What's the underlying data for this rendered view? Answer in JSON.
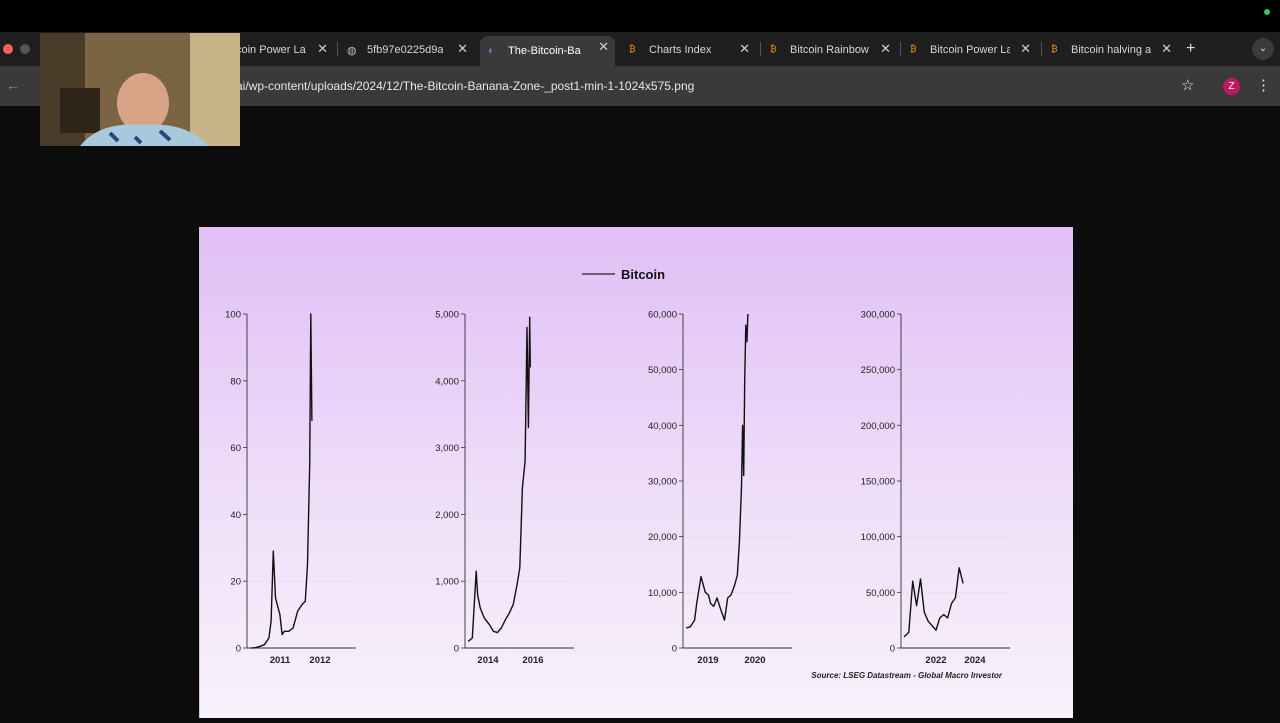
{
  "browser": {
    "tabs": [
      {
        "label": "coin Power La",
        "favicon": "bitcoin-icon"
      },
      {
        "label": "5fb97e0225d9a",
        "favicon": "globe-icon"
      },
      {
        "label": "The-Bitcoin-Ba",
        "favicon": "site-icon",
        "active": true
      },
      {
        "label": "Charts Index",
        "favicon": "bitcoin-icon"
      },
      {
        "label": "Bitcoin Rainbow",
        "favicon": "bitcoin-icon"
      },
      {
        "label": "Bitcoin Power La",
        "favicon": "bitcoin-icon"
      },
      {
        "label": "Bitcoin halving a",
        "favicon": "bitcoin-icon"
      }
    ],
    "new_tab": "+",
    "url": "ai/wp-content/uploads/2024/12/The-Bitcoin-Banana-Zone-_post1-min-1-1024x575.png",
    "profile_initial": "Z",
    "close_glyph": "✕"
  },
  "chart_data": {
    "type": "line",
    "legend": "Bitcoin",
    "source": "Source: LSEG Datastream - Global Macro Investor",
    "panels": [
      {
        "yticks": [
          "100",
          "80",
          "60",
          "40",
          "20",
          "0"
        ],
        "ymax": 100,
        "xticks": [
          "2011",
          "2012"
        ],
        "x": [
          2010.5,
          2010.7,
          2010.9,
          2011.1,
          2011.3,
          2011.4,
          2011.5,
          2011.6,
          2011.8,
          2011.9,
          2012.0,
          2012.2,
          2012.4,
          2012.6,
          2012.8,
          2012.95,
          2013.05,
          2013.15,
          2013.2,
          2013.25
        ],
        "y": [
          0,
          0.1,
          0.5,
          1,
          3,
          8,
          29,
          15,
          10,
          4,
          5,
          5,
          6,
          11,
          13,
          14,
          25,
          55,
          100,
          68
        ]
      },
      {
        "yticks": [
          "5,000",
          "4,000",
          "3,000",
          "2,000",
          "1,000",
          "0"
        ],
        "ymax": 5000,
        "xticks": [
          "2014",
          "2016"
        ],
        "x": [
          2013.3,
          2013.6,
          2013.9,
          2014.0,
          2014.2,
          2014.5,
          2014.9,
          2015.2,
          2015.5,
          2015.8,
          2016.1,
          2016.4,
          2016.7,
          2017.0,
          2017.2,
          2017.4,
          2017.6,
          2017.75,
          2017.85,
          2017.95,
          2018.0
        ],
        "y": [
          100,
          150,
          1150,
          800,
          600,
          450,
          350,
          250,
          230,
          300,
          420,
          520,
          650,
          950,
          1200,
          2400,
          2800,
          4800,
          3300,
          4950,
          4200
        ]
      },
      {
        "yticks": [
          "60,000",
          "50,000",
          "40,000",
          "30,000",
          "20,000",
          "10,000",
          "0"
        ],
        "ymax": 60000,
        "xticks": [
          "2019",
          "2020"
        ],
        "x": [
          2018.4,
          2018.6,
          2018.8,
          2018.9,
          2019.1,
          2019.3,
          2019.45,
          2019.55,
          2019.7,
          2019.85,
          2020.0,
          2020.2,
          2020.35,
          2020.5,
          2020.65,
          2020.8,
          2020.9,
          2021.0,
          2021.05,
          2021.1,
          2021.15,
          2021.2,
          2021.25,
          2021.3
        ],
        "y": [
          3600,
          3800,
          5000,
          8000,
          12800,
          10000,
          9500,
          8000,
          7500,
          9000,
          7200,
          5000,
          9000,
          9500,
          11000,
          13000,
          19000,
          29000,
          40000,
          31000,
          48000,
          58000,
          55000,
          60000
        ]
      },
      {
        "yticks": [
          "300,000",
          "250,000",
          "200,000",
          "150,000",
          "100,000",
          "50,000",
          "0"
        ],
        "ymax": 300000,
        "xticks": [
          "2022",
          "2024"
        ],
        "x": [
          2021.35,
          2021.6,
          2021.8,
          2022.0,
          2022.2,
          2022.4,
          2022.6,
          2022.8,
          2023.0,
          2023.2,
          2023.4,
          2023.6,
          2023.8,
          2024.0,
          2024.2,
          2024.4
        ],
        "y": [
          10000,
          14000,
          60000,
          38000,
          62000,
          32000,
          24000,
          20000,
          16000,
          27000,
          30000,
          27000,
          40000,
          45000,
          72000,
          58000
        ]
      }
    ]
  }
}
